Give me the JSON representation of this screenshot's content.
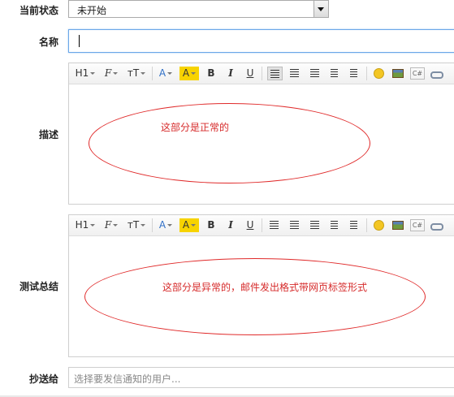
{
  "form": {
    "status_label": "当前状态",
    "status_value": "未开始",
    "name_label": "名称",
    "name_value": "",
    "desc_label": "描述",
    "desc_note": "这部分是正常的",
    "summary_label": "测试总结",
    "summary_note": "这部分是异常的，邮件发出格式带网页标签形式",
    "cc_label": "抄送给",
    "cc_placeholder": "选择要发信通知的用户..."
  },
  "toolbar": {
    "heading": "H1",
    "font_family": "F",
    "font_size": "тT",
    "font_color": "A",
    "bg_color": "A",
    "bold": "B",
    "italic": "I",
    "underline": "U",
    "code_label": "C#"
  },
  "colors": {
    "annotation": "#d62b2b",
    "focus_border": "#6aa6e8",
    "highlight": "#f7d300"
  }
}
